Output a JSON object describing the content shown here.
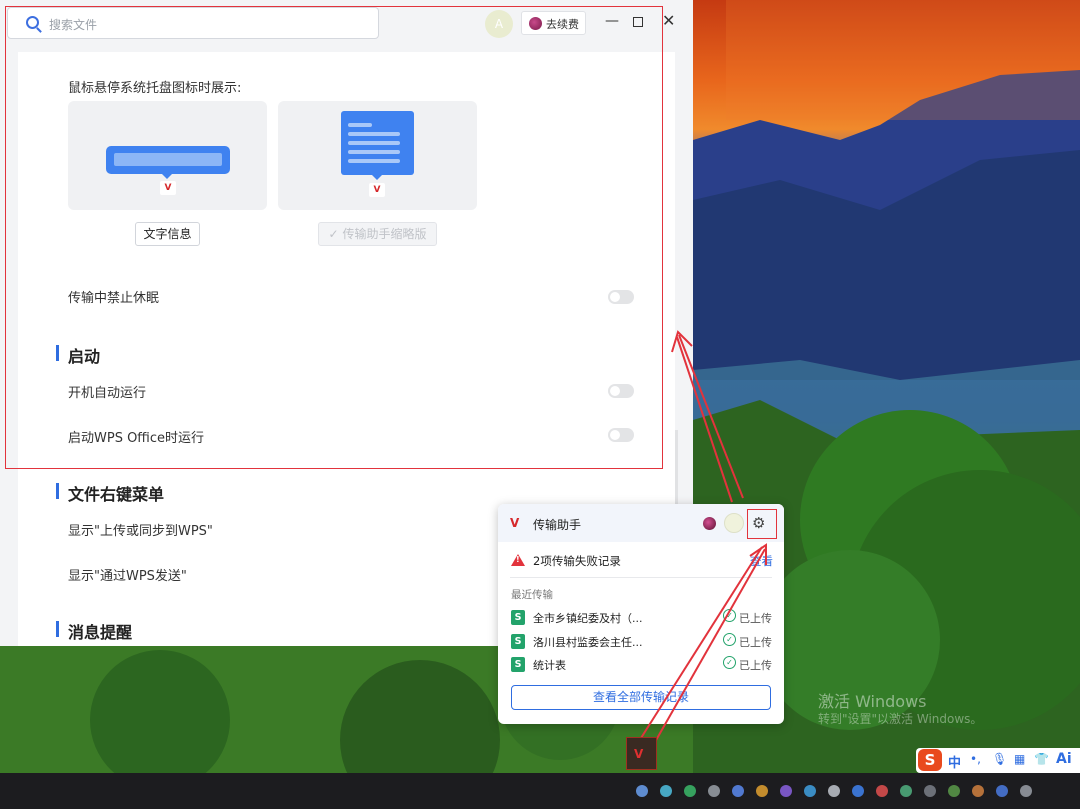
{
  "window": {
    "search_placeholder": "搜索文件",
    "avatar_initial": "A",
    "renew_label": "去续费",
    "minimize": "—",
    "close": "✕"
  },
  "settings": {
    "tray_hover_label": "鼠标悬停系统托盘图标时展示:",
    "option_text_info": "文字信息",
    "option_mini_assistant": "传输助手缩略版",
    "no_sleep_label": "传输中禁止休眠",
    "startup_heading": "启动",
    "autostart_label": "开机自动运行",
    "wps_start_label": "启动WPS Office时运行",
    "context_menu_heading": "文件右键菜单",
    "show_upload_sync": "显示\"上传或同步到WPS\"",
    "show_send_wps": "显示\"通过WPS发送\"",
    "notify_heading": "消息提醒",
    "toggles": {
      "no_sleep": false,
      "autostart": false,
      "wps_start": false
    }
  },
  "popup": {
    "title": "传输助手",
    "failure_text": "2项传输失败记录",
    "view_link": "查看",
    "recent_label": "最近传输",
    "files": [
      {
        "icon": "S",
        "name": "全市乡镇纪委及村（...",
        "status": "已上传"
      },
      {
        "icon": "S",
        "name": "洛川县村监委会主任...",
        "status": "已上传"
      },
      {
        "icon": "S",
        "name": "统计表",
        "status": "已上传"
      }
    ],
    "view_all_button": "查看全部传输记录"
  },
  "desktop": {
    "watermark_line1": "激活 Windows",
    "watermark_line2": "转到\"设置\"以激活 Windows。"
  },
  "ime": {
    "logo": "S",
    "lang": "中",
    "ai": "Ai"
  },
  "colors": {
    "accent": "#2f6de0",
    "highlight_box": "#e2333c",
    "success": "#23a36b"
  }
}
